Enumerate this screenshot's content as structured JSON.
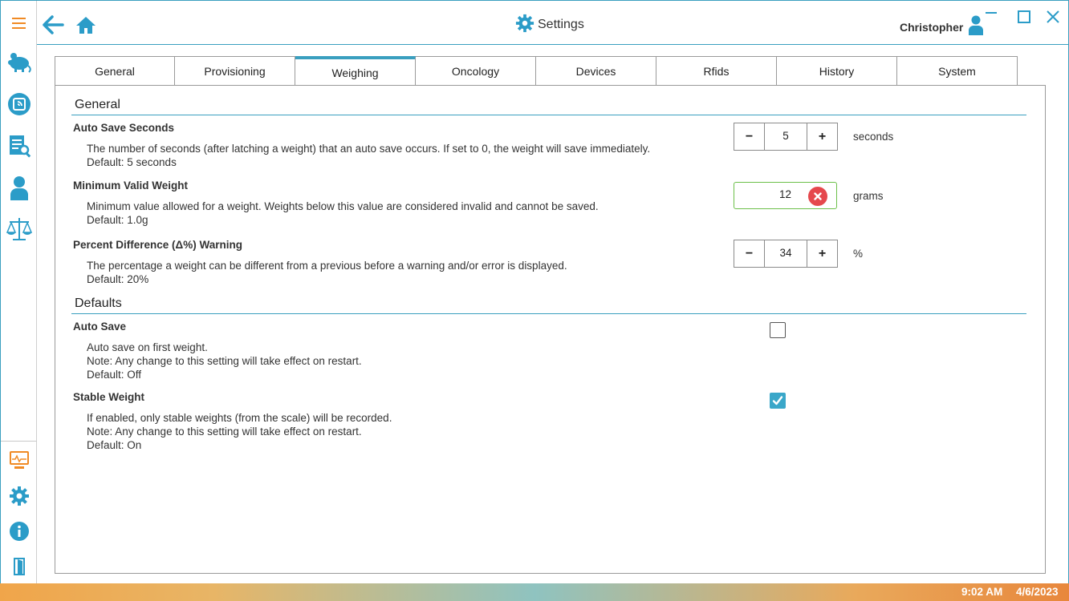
{
  "window": {
    "title": "Settings",
    "user_name": "Christopher"
  },
  "tabs": [
    {
      "label": "General",
      "active": false
    },
    {
      "label": "Provisioning",
      "active": false
    },
    {
      "label": "Weighing",
      "active": true
    },
    {
      "label": "Oncology",
      "active": false
    },
    {
      "label": "Devices",
      "active": false
    },
    {
      "label": "Rfids",
      "active": false
    },
    {
      "label": "History",
      "active": false
    },
    {
      "label": "System",
      "active": false
    }
  ],
  "sections": {
    "general": {
      "title": "General",
      "auto_save_seconds": {
        "name": "Auto Save Seconds",
        "desc1": "The number of seconds (after latching a weight) that an auto save occurs. If set to 0, the weight will save immediately.",
        "desc2": "Default: 5 seconds",
        "value": "5",
        "unit": "seconds",
        "minus": "−",
        "plus": "+"
      },
      "min_valid_weight": {
        "name": "Minimum Valid Weight",
        "desc1": "Minimum value allowed for a weight. Weights below this value are considered invalid and cannot be saved.",
        "desc2": "Default: 1.0g",
        "value": "12",
        "unit": "grams"
      },
      "percent_diff": {
        "name": "Percent Difference (Δ%) Warning",
        "desc1": "The percentage a weight can be different from a previous before a warning and/or error is displayed.",
        "desc2": "Default: 20%",
        "value": "34",
        "unit": "%",
        "minus": "−",
        "plus": "+"
      }
    },
    "defaults": {
      "title": "Defaults",
      "auto_save": {
        "name": "Auto Save",
        "desc1": "Auto save on first weight.",
        "desc2": "Note: Any change to this setting will take effect on restart.",
        "desc3": "Default: Off",
        "checked": false
      },
      "stable_weight": {
        "name": "Stable Weight",
        "desc1": "If enabled, only stable weights (from the scale) will be recorded.",
        "desc2": "Note: Any change to this setting will take effect on restart.",
        "desc3": "Default: On",
        "checked": true
      }
    }
  },
  "status": {
    "time": "9:02 AM",
    "date": "4/6/2023"
  },
  "colors": {
    "accent": "#3a9fbf",
    "sidebar_icon": "#2b9cc8",
    "menu_icon": "#f08a24",
    "valid_border": "#6cc04a",
    "clear_button": "#e5484d"
  },
  "icons": {
    "sidebar_top": [
      "menu-icon",
      "mouse-icon",
      "scan-icon",
      "document-search-icon",
      "person-icon",
      "scale-icon"
    ],
    "sidebar_bottom": [
      "monitor-icon",
      "gear-icon",
      "info-icon",
      "exit-door-icon"
    ]
  }
}
